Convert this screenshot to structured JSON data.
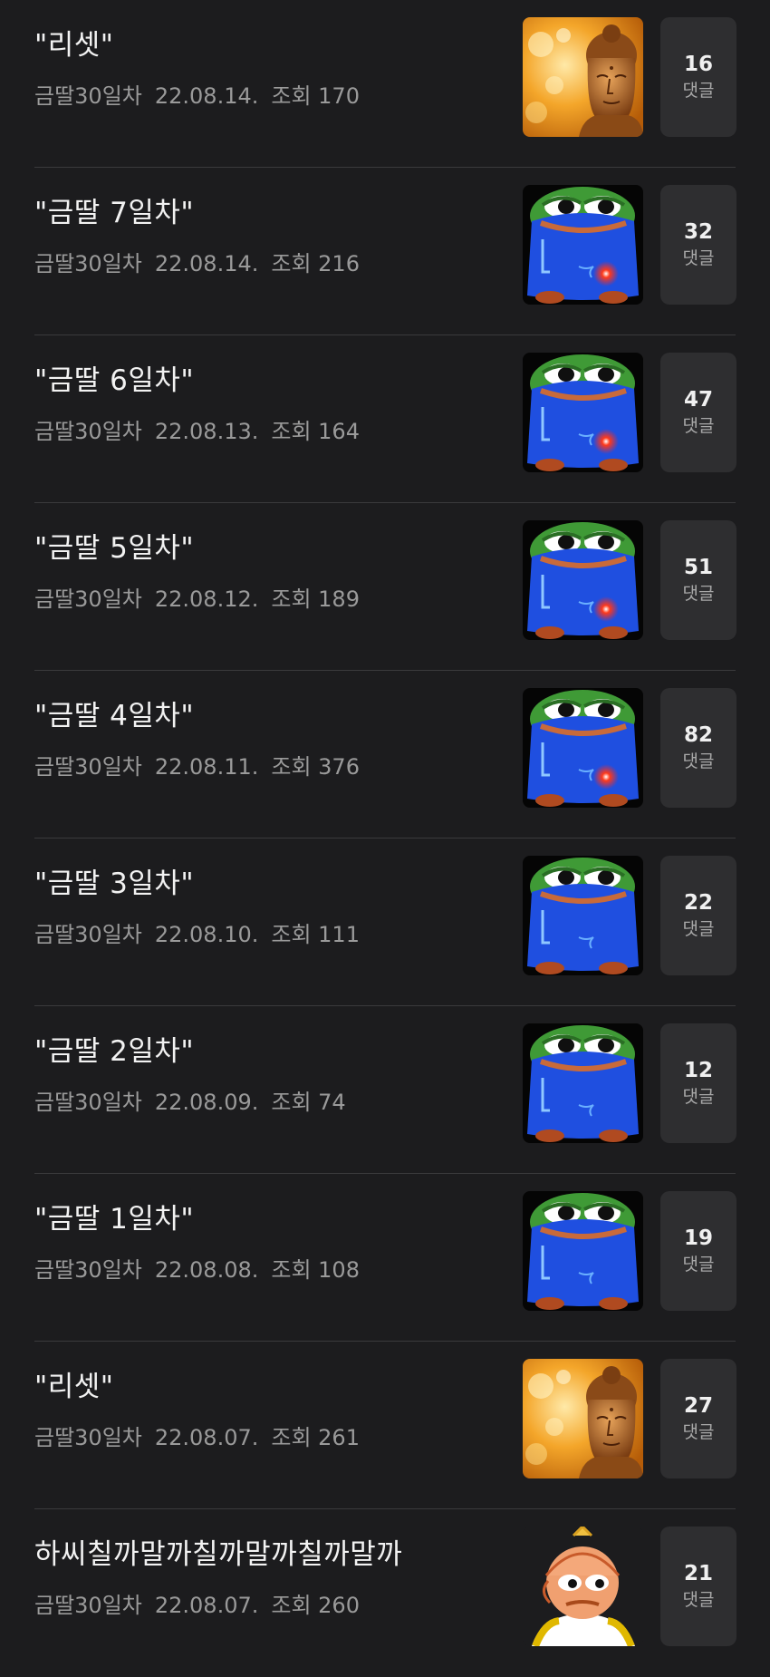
{
  "meta_label": "댓글",
  "posts": [
    {
      "title": "\"리셋\"",
      "author": "금딸30일차",
      "date": "22.08.14.",
      "views": "조회 170",
      "comments": "16",
      "thumb": "buddha-image"
    },
    {
      "title": "\"금딸 7일차\"",
      "author": "금딸30일차",
      "date": "22.08.14.",
      "views": "조회 216",
      "comments": "32",
      "thumb": "pepe-blanket-red-image"
    },
    {
      "title": "\"금딸 6일차\"",
      "author": "금딸30일차",
      "date": "22.08.13.",
      "views": "조회 164",
      "comments": "47",
      "thumb": "pepe-blanket-red-image"
    },
    {
      "title": "\"금딸 5일차\"",
      "author": "금딸30일차",
      "date": "22.08.12.",
      "views": "조회 189",
      "comments": "51",
      "thumb": "pepe-blanket-red-image"
    },
    {
      "title": "\"금딸 4일차\"",
      "author": "금딸30일차",
      "date": "22.08.11.",
      "views": "조회 376",
      "comments": "82",
      "thumb": "pepe-blanket-red-image"
    },
    {
      "title": "\"금딸 3일차\"",
      "author": "금딸30일차",
      "date": "22.08.10.",
      "views": "조회 111",
      "comments": "22",
      "thumb": "pepe-blanket-image"
    },
    {
      "title": "\"금딸 2일차\"",
      "author": "금딸30일차",
      "date": "22.08.09.",
      "views": "조회 74",
      "comments": "12",
      "thumb": "pepe-blanket-image"
    },
    {
      "title": "\"금딸 1일차\"",
      "author": "금딸30일차",
      "date": "22.08.08.",
      "views": "조회 108",
      "comments": "19",
      "thumb": "pepe-blanket-image"
    },
    {
      "title": "\"리셋\"",
      "author": "금딸30일차",
      "date": "22.08.07.",
      "views": "조회 261",
      "comments": "27",
      "thumb": "buddha-image"
    },
    {
      "title": "하씨칠까말까칠까말까칠까말까",
      "author": "금딸30일차",
      "date": "22.08.07.",
      "views": "조회 260",
      "comments": "21",
      "thumb": "pepe-monk-image"
    }
  ]
}
